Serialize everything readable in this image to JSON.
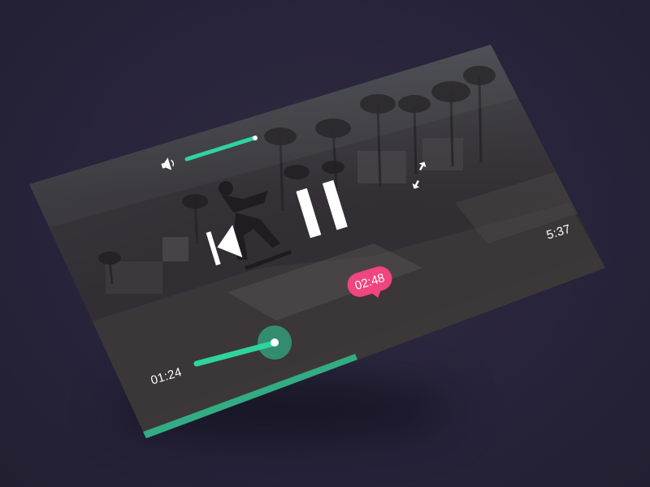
{
  "player": {
    "current_time": "01:24",
    "total_time": "5:37",
    "hover_time": "02:48",
    "progress": 0.25,
    "volume": 0.9,
    "state": "playing"
  },
  "controls": {
    "previous": "previous-icon",
    "pause": "pause-icon",
    "volume": "speaker-icon",
    "fullscreen": "fullscreen-icon"
  },
  "colors": {
    "accent": "#2fd39e",
    "bubble": "#f0457e",
    "background": "#2a2638"
  }
}
